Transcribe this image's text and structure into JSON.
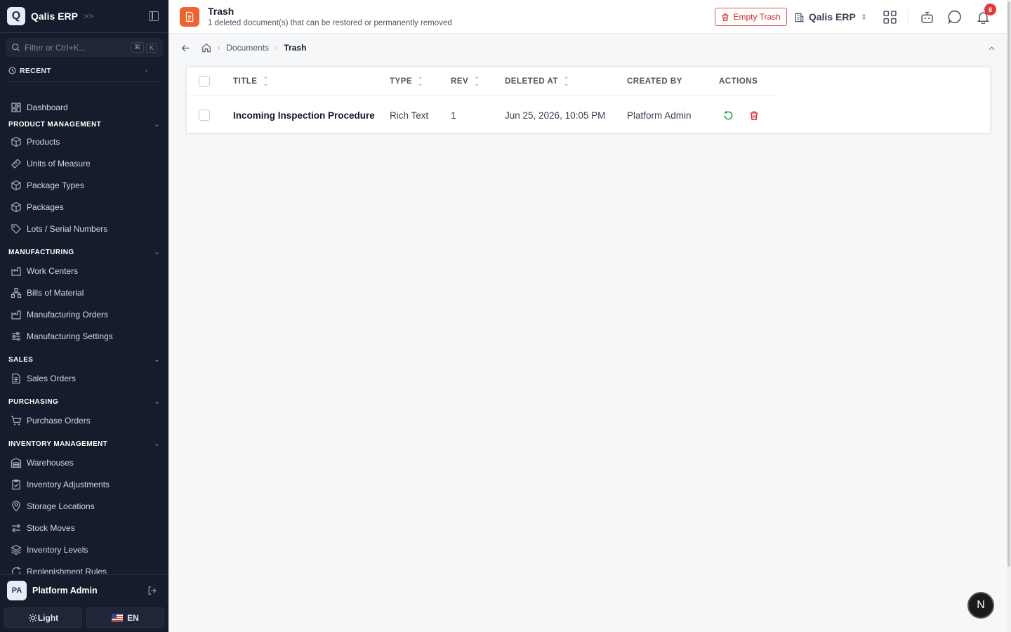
{
  "app": {
    "logo_letter": "Q",
    "name": "Qalis ERP"
  },
  "sidebar": {
    "filter_placeholder": "Filter or Ctrl+K...",
    "filter_kbd": [
      "⌘",
      "K"
    ],
    "recent_label": "RECENT",
    "dashboard_label": "Dashboard",
    "sections": [
      {
        "title": "PRODUCT MANAGEMENT",
        "items": [
          "Products",
          "Units of Measure",
          "Package Types",
          "Packages",
          "Lots / Serial Numbers"
        ]
      },
      {
        "title": "MANUFACTURING",
        "items": [
          "Work Centers",
          "Bills of Material",
          "Manufacturing Orders",
          "Manufacturing Settings"
        ]
      },
      {
        "title": "SALES",
        "items": [
          "Sales Orders"
        ]
      },
      {
        "title": "PURCHASING",
        "items": [
          "Purchase Orders"
        ]
      },
      {
        "title": "INVENTORY MANAGEMENT",
        "items": [
          "Warehouses",
          "Inventory Adjustments",
          "Storage Locations",
          "Stock Moves",
          "Inventory Levels",
          "Replenishment Rules"
        ]
      }
    ],
    "user": {
      "initials": "PA",
      "name": "Platform Admin"
    },
    "theme_label": "Light",
    "lang_label": "EN"
  },
  "header": {
    "title": "Trash",
    "subtitle": "1 deleted document(s) that can be restored or permanently removed",
    "empty_trash_label": "Empty Trash",
    "company": "Qalis ERP",
    "notification_count": "8"
  },
  "breadcrumb": {
    "items": [
      "Documents",
      "Trash"
    ]
  },
  "table": {
    "columns": [
      "TITLE",
      "TYPE",
      "REV",
      "DELETED AT",
      "CREATED BY",
      "ACTIONS"
    ],
    "rows": [
      {
        "title": "Incoming Inspection Procedure",
        "type": "Rich Text",
        "rev": "1",
        "deleted_at": "Jun 25, 2026, 10:05 PM",
        "created_by": "Platform Admin"
      }
    ]
  },
  "fab_label": "N",
  "colors": {
    "sidebar_bg": "#151c2b",
    "accent_orange": "#f0622e",
    "danger": "#dc2626",
    "restore_green": "#16a34a"
  }
}
